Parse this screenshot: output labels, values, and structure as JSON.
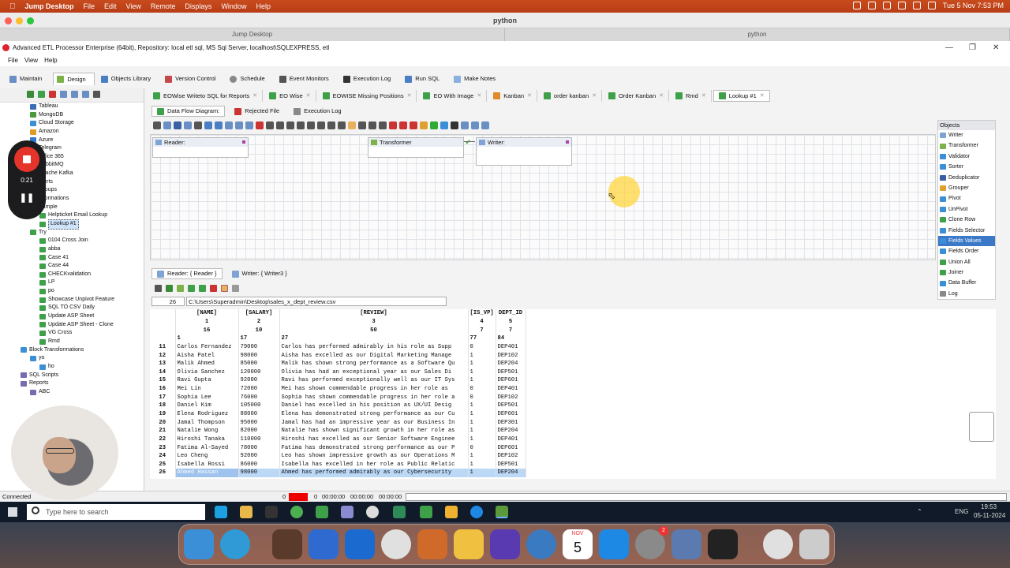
{
  "mac": {
    "app_name": "Jump Desktop",
    "menu": [
      "File",
      "Edit",
      "View",
      "Remote",
      "Displays",
      "Window",
      "Help"
    ],
    "clock": "Tue 5 Nov  7:53 PM"
  },
  "jump": {
    "title": "python",
    "tabs": [
      "Jump Desktop",
      "python"
    ]
  },
  "app": {
    "title": "Advanced ETL Processor Enterprise (64bit), Repository: local etl sql, MS Sql Server, localhost\\SQLEXPRESS, etl",
    "menu": [
      "File",
      "View",
      "Help"
    ],
    "main_tabs": [
      "Maintain",
      "Design",
      "Objects Library",
      "Version Control",
      "Schedule",
      "Event Monitors",
      "Execution Log",
      "Run SQL",
      "Make Notes"
    ],
    "active_main_tab": "Design"
  },
  "tree": {
    "items": [
      {
        "label": "Tableau",
        "indent": 2,
        "color": "#3b6db3"
      },
      {
        "label": "MongoDB",
        "indent": 2,
        "color": "#4a9a3a"
      },
      {
        "label": "Cloud Storage",
        "indent": 2,
        "color": "#3b8fd6"
      },
      {
        "label": "Amazon",
        "indent": 2,
        "color": "#e09a2a"
      },
      {
        "label": "Azure",
        "indent": 2,
        "color": "#2f7ad0"
      },
      {
        "label": "Telegram",
        "indent": 2,
        "color": "#2f9ad6"
      },
      {
        "label": "Office 365",
        "indent": 2,
        "color": "#d35d2a"
      },
      {
        "label": "RabbitMQ",
        "indent": 2,
        "color": "#e06b2a"
      },
      {
        "label": "Apache Kafka",
        "indent": 2,
        "color": "#333333"
      },
      {
        "label": "Alerts",
        "indent": 2,
        "color": "#5a8a3a"
      },
      {
        "label": "Groups",
        "indent": 2,
        "color": "#5a8a3a"
      },
      {
        "label": "Transformations",
        "indent": 1,
        "color": "#3fa04a"
      },
      {
        "label": "Sample",
        "indent": 2,
        "color": "#3fa04a"
      },
      {
        "label": "Helpticket Email Lookup",
        "indent": 3,
        "color": "#3fa04a"
      },
      {
        "label": "Lookup #1",
        "indent": 3,
        "color": "#3fa04a",
        "selected": true
      },
      {
        "label": "Try",
        "indent": 2,
        "color": "#3fa04a"
      },
      {
        "label": "0104 Cross Join",
        "indent": 3,
        "color": "#3fa04a"
      },
      {
        "label": "abba",
        "indent": 3,
        "color": "#3fa04a"
      },
      {
        "label": "Case 41",
        "indent": 3,
        "color": "#3fa04a"
      },
      {
        "label": "Case 44",
        "indent": 3,
        "color": "#3fa04a"
      },
      {
        "label": "CHECKvalidation",
        "indent": 3,
        "color": "#3fa04a"
      },
      {
        "label": "LP",
        "indent": 3,
        "color": "#3fa04a"
      },
      {
        "label": "po",
        "indent": 3,
        "color": "#3fa04a"
      },
      {
        "label": "Showcase Unpivot Feature",
        "indent": 3,
        "color": "#3fa04a"
      },
      {
        "label": "SQL TO CSV Daily",
        "indent": 3,
        "color": "#3fa04a"
      },
      {
        "label": "Update ASP Sheet",
        "indent": 3,
        "color": "#3fa04a"
      },
      {
        "label": "Update ASP Sheet - Clone",
        "indent": 3,
        "color": "#3fa04a"
      },
      {
        "label": "VG Cross",
        "indent": 3,
        "color": "#3fa04a"
      },
      {
        "label": "Rmd",
        "indent": 3,
        "color": "#3fa04a"
      },
      {
        "label": "Block Transformations",
        "indent": 1,
        "color": "#3b8fd6"
      },
      {
        "label": "yo",
        "indent": 2,
        "color": "#3b8fd6"
      },
      {
        "label": "ho",
        "indent": 3,
        "color": "#3b8fd6"
      },
      {
        "label": "SQL Scripts",
        "indent": 1,
        "color": "#7a6ab0"
      },
      {
        "label": "Reports",
        "indent": 1,
        "color": "#7a6ab0"
      },
      {
        "label": "ABC",
        "indent": 2,
        "color": "#7a6ab0"
      }
    ]
  },
  "doc_tabs": [
    "EOWise Writeto SQL for Reports",
    "EO Wise",
    "EOWISE Missing Positions",
    "EO With Image",
    "Kanban",
    "order kanban",
    "Order Kanban",
    "Rmd",
    "Lookup #1"
  ],
  "active_doc_tab": "Lookup #1",
  "sub_tabs": [
    "Data Flow Diagram:",
    "Rejected File",
    "Execution Log"
  ],
  "canvas": {
    "nodes": {
      "reader": "Reader:",
      "transformer": "Transformer",
      "writer": "Writer:"
    }
  },
  "objects_panel": {
    "title": "Objects",
    "items": [
      "Writer",
      "Transformer",
      "Validator",
      "Sorter",
      "Deduplicator",
      "Grouper",
      "Pivot",
      "UnPivot",
      "Clone Row",
      "Fields Selector",
      "Fields Values",
      "Fields Order",
      "Union All",
      "Joiner",
      "Data Buffer",
      "Log"
    ],
    "selected": "Fields Values"
  },
  "lower_tabs": [
    "Reader: { Reader }",
    "Writer: { Writer3 }"
  ],
  "reader": {
    "row_count": "26",
    "file_path": "C:\\Users\\Superadmin\\Desktop\\sales_x_dept_review.csv"
  },
  "grid": {
    "headers": [
      "[NAME]",
      "[SALARY]",
      "[REVIEW]",
      "[IS_VP]",
      "DEPT_ID"
    ],
    "field_nums": [
      "1",
      "2",
      "3",
      "4",
      "5"
    ],
    "widths": [
      "16",
      "10",
      "50",
      "7",
      "7"
    ],
    "positions": [
      "1",
      "17",
      "27",
      "77",
      "84"
    ],
    "rows": [
      {
        "n": "11",
        "name": "Carlos Fernandez",
        "salary": "79000",
        "review": "Carlos has performed admirably in his role as Supp",
        "vp": "0",
        "dept": "DEP401"
      },
      {
        "n": "12",
        "name": "Aisha Patel",
        "salary": "98000",
        "review": "Aisha has excelled as our Digital Marketing Manage",
        "vp": "1",
        "dept": "DEP102"
      },
      {
        "n": "13",
        "name": "Malik Ahmed",
        "salary": "85000",
        "review": "Malik has shown strong performance as a Software Qu",
        "vp": "1",
        "dept": "DEP204"
      },
      {
        "n": "14",
        "name": "Olivia Sanchez",
        "salary": "120000",
        "review": "Olivia has had an exceptional year as our Sales Di",
        "vp": "1",
        "dept": "DEP501"
      },
      {
        "n": "15",
        "name": "Ravi Gupta",
        "salary": "92000",
        "review": "Ravi has performed exceptionally well as our IT Sys",
        "vp": "1",
        "dept": "DEP601"
      },
      {
        "n": "16",
        "name": "Mei Lin",
        "salary": "72000",
        "review": "Mei has shown commendable progress in her role as ",
        "vp": "0",
        "dept": "DEP401"
      },
      {
        "n": "17",
        "name": "Sophia Lee",
        "salary": "76000",
        "review": "Sophia has shown commendable progress in her role a",
        "vp": "0",
        "dept": "DEP102"
      },
      {
        "n": "18",
        "name": "Daniel Kim",
        "salary": "105000",
        "review": "Daniel has excelled in his position as UX/UI Desig",
        "vp": "1",
        "dept": "DEP501"
      },
      {
        "n": "19",
        "name": "Elena Rodriguez",
        "salary": "88000",
        "review": "Elena has demonstrated strong performance as our Cu",
        "vp": "1",
        "dept": "DEP601"
      },
      {
        "n": "20",
        "name": "Jamal Thompson",
        "salary": "95000",
        "review": "Jamal has had an impressive year as our Business In",
        "vp": "1",
        "dept": "DEP301"
      },
      {
        "n": "21",
        "name": "Natalie Wong",
        "salary": "82000",
        "review": "Natalie has shown significant growth in her role as",
        "vp": "1",
        "dept": "DEP204"
      },
      {
        "n": "22",
        "name": "Hiroshi Tanaka",
        "salary": "110000",
        "review": "Hiroshi has excelled as our Senior Software Enginee",
        "vp": "1",
        "dept": "DEP401"
      },
      {
        "n": "23",
        "name": "Fatima Al-Sayed",
        "salary": "78000",
        "review": "Fatima has demonstrated strong performance as our P",
        "vp": "0",
        "dept": "DEP601"
      },
      {
        "n": "24",
        "name": "Leo Cheng",
        "salary": "92000",
        "review": "Leo has shown impressive growth as our Operations M",
        "vp": "1",
        "dept": "DEP102"
      },
      {
        "n": "25",
        "name": "Isabella Rossi",
        "salary": "86000",
        "review": "Isabella has excelled in her role as Public Relatic",
        "vp": "1",
        "dept": "DEP501"
      },
      {
        "n": "26",
        "name": "Ahmed Hassan",
        "salary": "98000",
        "review": "Ahmed has performed admirably as our Cybersecurity ",
        "vp": "1",
        "dept": "DEP204",
        "selected": true
      }
    ]
  },
  "status": {
    "connection": "Connected",
    "counter1": "0",
    "counter2": "0",
    "t1": "00:00:00",
    "t2": "00:00:00",
    "t3": "00:00:00"
  },
  "recorder": {
    "time": "0:21"
  },
  "win_taskbar": {
    "search_placeholder": "Type here to search",
    "lang": "ENG",
    "time": "19:53",
    "date": "05-11-2024"
  },
  "dock": {
    "calendar_month": "NOV",
    "calendar_day": "5",
    "badge": "2"
  }
}
